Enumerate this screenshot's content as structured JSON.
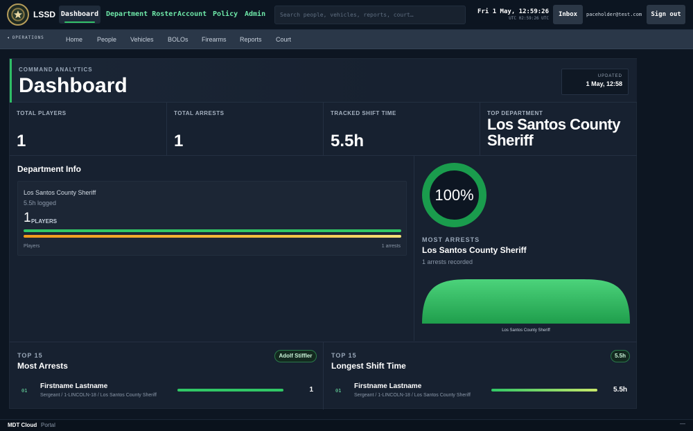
{
  "brand": {
    "name": "LSSD",
    "logo_icon": "sheriff-badge-icon"
  },
  "topnav": [
    {
      "label": "Dashboard",
      "active": true
    },
    {
      "label": "Department Roster"
    },
    {
      "label": "Account"
    },
    {
      "label": "Policy"
    },
    {
      "label": "Admin"
    }
  ],
  "search": {
    "placeholder": "Search people, vehicles, reports, court…"
  },
  "clock": {
    "local": "Fri 1 May, 12:59:26",
    "utc": "UTC 02:59:26 UTC"
  },
  "actions": {
    "inbox": "Inbox",
    "user": "paceholder@test.com",
    "signout": "Sign out"
  },
  "subnav": {
    "section": "OPERATIONS",
    "items": [
      "Home",
      "People",
      "Vehicles",
      "BOLOs",
      "Firearms",
      "Reports",
      "Court"
    ]
  },
  "header": {
    "eyebrow": "COMMAND ANALYTICS",
    "title": "Dashboard",
    "updated_label": "UPDATED",
    "updated_value": "1 May, 12:58"
  },
  "stats": [
    {
      "label": "TOTAL PLAYERS",
      "value": "1"
    },
    {
      "label": "TOTAL ARRESTS",
      "value": "1"
    },
    {
      "label": "TRACKED SHIFT TIME",
      "value": "5.5h"
    },
    {
      "label": "TOP DEPARTMENT",
      "value": "Los Santos County Sheriff"
    }
  ],
  "department_info": {
    "title": "Department Info",
    "card": {
      "name": "Los Santos County Sheriff",
      "logged": "5.5h logged",
      "count": "1",
      "count_label": "PLAYERS",
      "left_footer": "Players",
      "right_footer": "1 arrests",
      "players_fraction": 1.0,
      "arrests_fraction": 1.0
    }
  },
  "most_arrests": {
    "percent_text": "100%",
    "percent": 100,
    "label": "MOST ARRESTS",
    "dept": "Los Santos County Sheriff",
    "sub": "1 arrests recorded",
    "chart_caption": "Los Santos County Sheriff"
  },
  "top_arrests": {
    "eyebrow": "TOP 15",
    "title": "Most Arrests",
    "pill": "Adolf Stiffler",
    "rows": [
      {
        "rank": "01",
        "name": "Firstname Lastname",
        "info": "Sergeant / 1-LINCOLN-18 / Los Santos County Sheriff",
        "value": "1",
        "fraction": 1.0
      }
    ]
  },
  "top_shift": {
    "eyebrow": "TOP 15",
    "title": "Longest Shift Time",
    "pill": "5.5h",
    "rows": [
      {
        "rank": "01",
        "name": "Firstname Lastname",
        "info": "Sergeant / 1-LINCOLN-18 / Los Santos County Sheriff",
        "value": "5.5h",
        "fraction": 1.0
      }
    ]
  },
  "footer": {
    "app": "MDT Cloud",
    "section": "Portal",
    "collapse": "—"
  },
  "colors": {
    "accent_green": "#31c766",
    "accent_orange": "#f29a1c",
    "nav_green": "#6ee7a8"
  }
}
